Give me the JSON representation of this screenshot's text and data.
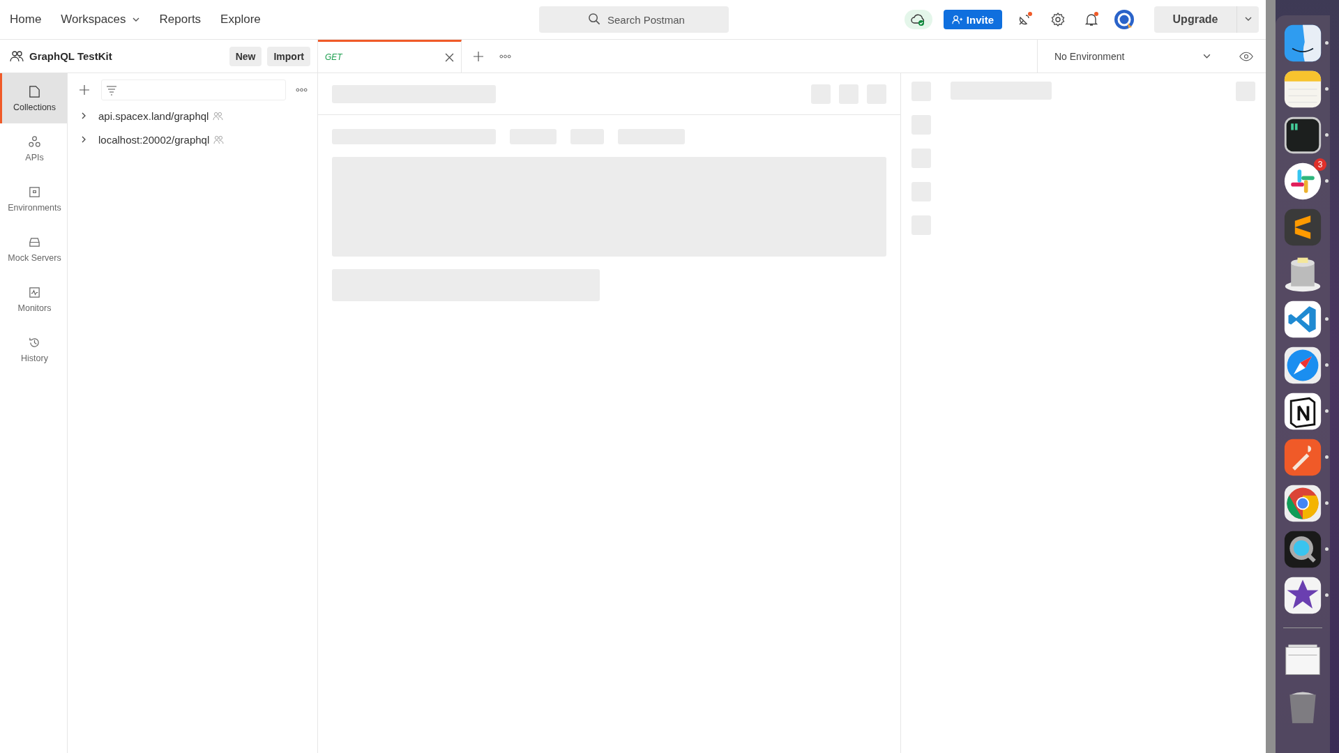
{
  "nav": [
    {
      "label": "Home",
      "dropdown": false
    },
    {
      "label": "Workspaces",
      "dropdown": true
    },
    {
      "label": "Reports",
      "dropdown": false
    },
    {
      "label": "Explore",
      "dropdown": false
    }
  ],
  "search": {
    "placeholder": "Search Postman"
  },
  "invite": "Invite",
  "upgrade": "Upgrade",
  "workspace": {
    "name": "GraphQL TestKit",
    "buttons": [
      "New",
      "Import"
    ]
  },
  "tabs": [
    {
      "method": "GET",
      "selected": true
    }
  ],
  "environment": {
    "value": "No Environment"
  },
  "rail": [
    {
      "label": "Collections",
      "kind": "collections",
      "selected": true
    },
    {
      "label": "APIs",
      "kind": "apis",
      "selected": false
    },
    {
      "label": "Environments",
      "kind": "environments",
      "selected": false
    },
    {
      "label": "Mock Servers",
      "kind": "mock",
      "selected": false
    },
    {
      "label": "Monitors",
      "kind": "monitors",
      "selected": false
    },
    {
      "label": "History",
      "kind": "history",
      "selected": false
    }
  ],
  "collections": [
    {
      "name": "api.spacex.land/graphql",
      "expanded": false
    },
    {
      "name": "localhost:20002/graphql",
      "expanded": false
    }
  ],
  "dock": [
    {
      "kind": "finder",
      "running": true
    },
    {
      "kind": "notes",
      "running": true
    },
    {
      "kind": "terminal",
      "running": true
    },
    {
      "kind": "slack",
      "running": true,
      "badge": "3"
    },
    {
      "kind": "sublime",
      "running": false
    },
    {
      "kind": "database",
      "running": false
    },
    {
      "kind": "vscode",
      "running": true
    },
    {
      "kind": "safari",
      "running": true
    },
    {
      "kind": "notion",
      "running": true
    },
    {
      "kind": "postman",
      "running": true
    },
    {
      "kind": "chrome",
      "running": true
    },
    {
      "kind": "quicktime",
      "running": true
    },
    {
      "kind": "imovie",
      "running": true
    },
    {
      "kind": "separator"
    },
    {
      "kind": "stack",
      "running": false
    },
    {
      "kind": "trash",
      "running": false
    }
  ]
}
